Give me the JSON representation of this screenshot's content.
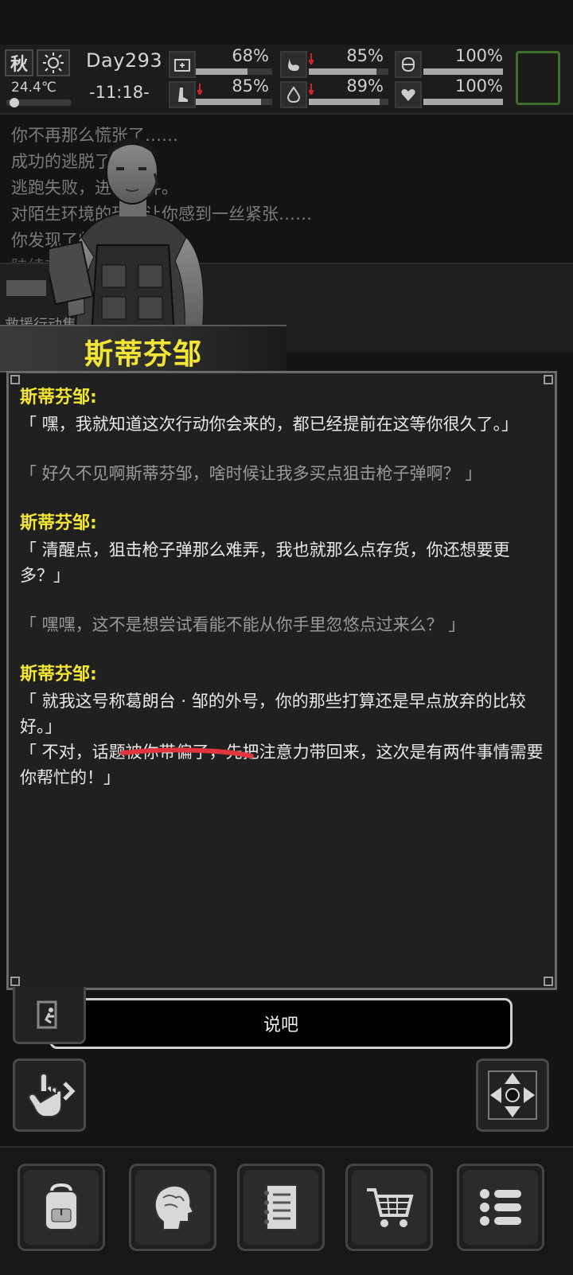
{
  "status": {
    "season": "秋",
    "weather_icon": "sun-icon",
    "temperature": "24.4℃",
    "temperature_level": 0.05,
    "day": "Day293",
    "time": "-11:18-",
    "stats": [
      {
        "name": "health",
        "icon": "medkit-icon",
        "value": "68%",
        "level": 0.68,
        "trend": ""
      },
      {
        "name": "hunger",
        "icon": "stomach-icon",
        "value": "85%",
        "level": 0.85,
        "trend": "down"
      },
      {
        "name": "stamina",
        "icon": "pill-icon",
        "value": "100%",
        "level": 1.0,
        "trend": ""
      },
      {
        "name": "energy",
        "icon": "leg-icon",
        "value": "85%",
        "level": 0.85,
        "trend": "down"
      },
      {
        "name": "thirst",
        "icon": "water-drop-icon",
        "value": "89%",
        "level": 0.89,
        "trend": "down"
      },
      {
        "name": "mood",
        "icon": "heart-icon",
        "value": "100%",
        "level": 1.0,
        "trend": ""
      }
    ],
    "accent_slot_color": "#3f6e2c"
  },
  "log": {
    "lines": [
      "你不再那么慌张了……",
      "成功的逃脱了战斗。",
      "逃跑失败，进入战斗。",
      "对陌生环境的恐惧让你感到一丝紧张……",
      "你发现了些东西……",
      "陆续有人进来了……"
    ],
    "location": "救援行动集合点"
  },
  "npc": {
    "name": "斯蒂芬邹"
  },
  "dialog": {
    "blocks": [
      {
        "speaker": "斯蒂芬邹:",
        "lines": [
          "「 嘿，我就知道这次行动你会来的，都已经提前在这等你很久了。」"
        ]
      },
      {
        "player": "「 好久不见啊斯蒂芬邹，啥时候让我多买点狙击枪子弹啊？ 」"
      },
      {
        "speaker": "斯蒂芬邹:",
        "lines": [
          "「 清醒点，狙击枪子弹那么难弄，我也就那么点存货，你还想要更多？」"
        ]
      },
      {
        "player": "「 嘿嘿，这不是想尝试看能不能从你手里忽悠点过来么？ 」"
      },
      {
        "speaker": "斯蒂芬邹:",
        "lines": [
          "「 就我这号称葛朗台 · 邹的外号，你的那些打算还是早点放弃的比较好。」",
          "「 不对，话题被你带偏了，先把注意力带回来，这次是有两件事情需要你帮忙的！」"
        ]
      }
    ],
    "highlight_color": "#e0353c"
  },
  "action": {
    "label": "说吧"
  },
  "side_buttons": {
    "left_top": "exit-icon",
    "left": "tap-gesture-icon",
    "right": "move-cross-icon"
  },
  "bottom_nav": [
    "backpack-icon",
    "brain-icon",
    "notebook-icon",
    "shopping-cart-icon",
    "menu-list-icon"
  ]
}
